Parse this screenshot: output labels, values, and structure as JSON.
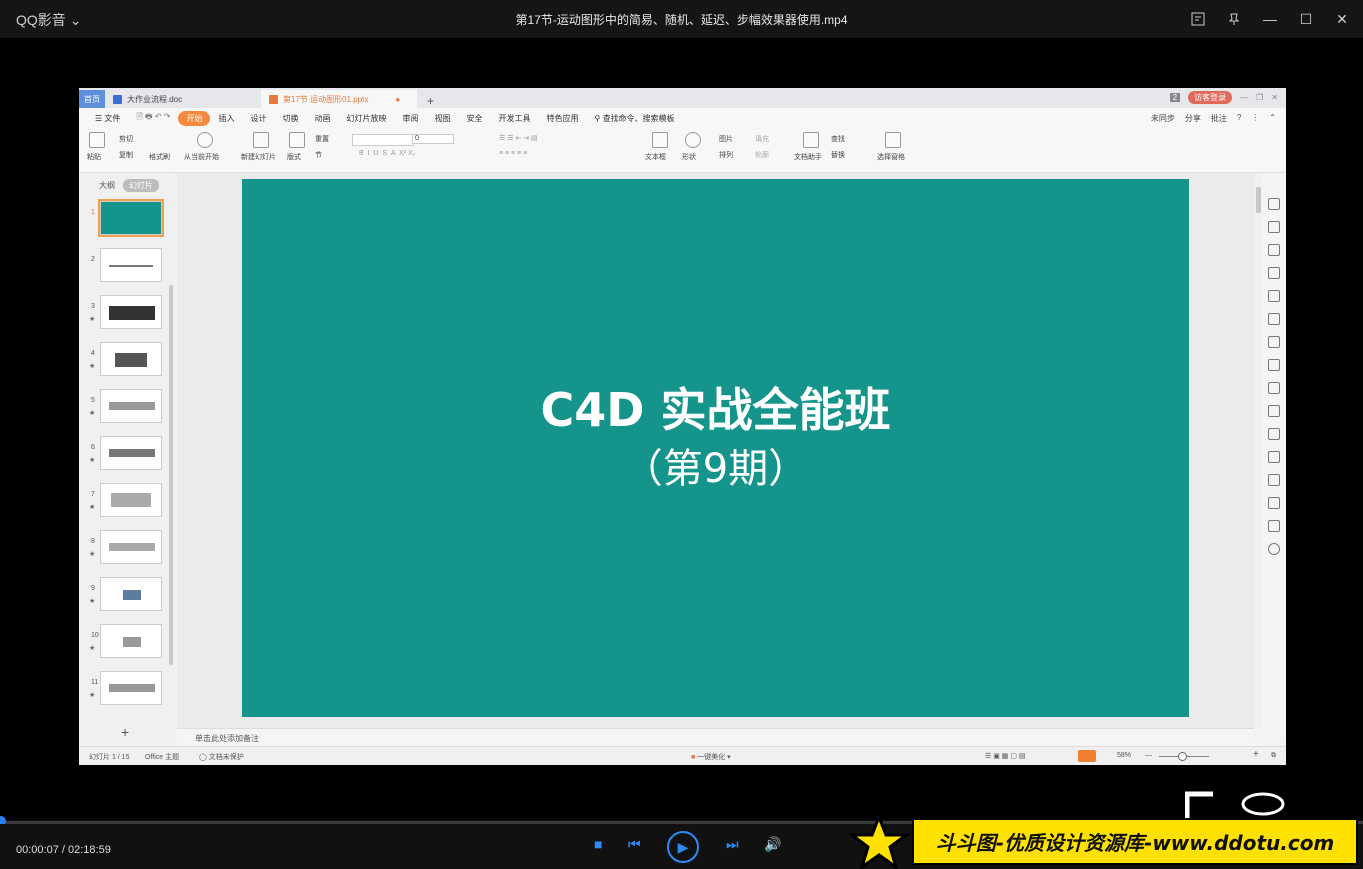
{
  "player": {
    "brand": "QQ影音",
    "title": "第17节-运动图形中的简易、随机、延迟、步幅效果器使用.mp4",
    "time": "00:00:07 / 02:18:59",
    "watermark": "斗斗图-优质设计资源库-www.ddotu.com"
  },
  "wps": {
    "tabs": {
      "home": "首页",
      "doc": "大作业流程.doc",
      "pptx": "第17节 运动图形01.pptx",
      "badge": "2",
      "login": "访客登录"
    },
    "menu": {
      "file": "文件",
      "items": [
        "开始",
        "插入",
        "设计",
        "切换",
        "动画",
        "幻灯片放映",
        "审阅",
        "视图",
        "安全",
        "开发工具",
        "特色应用"
      ],
      "search": "查找命令、搜索模板",
      "right": [
        "未同步",
        "分享",
        "批注"
      ]
    },
    "ribbon": {
      "paste": "粘贴",
      "cut": "剪切",
      "copy": "复制",
      "format_brush": "格式刷",
      "from_current": "从当前开始",
      "new_slide": "新建幻灯片",
      "layout": "版式",
      "section": "节",
      "reset": "重置",
      "font_size": "0",
      "textbox": "文本框",
      "shape": "形状",
      "picture": "图片",
      "arrange": "排列",
      "fill": "填充",
      "outline": "轮廓",
      "doc_helper": "文档助手",
      "find": "查找",
      "replace": "替换",
      "select_pane": "选择窗格"
    },
    "panel": {
      "outline": "大纲",
      "slides": "幻灯片",
      "numbers": [
        "1",
        "2",
        "3",
        "4",
        "5",
        "6",
        "7",
        "8",
        "9",
        "10",
        "11"
      ]
    },
    "slide": {
      "title": "C4D 实战全能班",
      "subtitle": "（第9期）"
    },
    "notes": "单击此处添加备注",
    "status": {
      "slide_count": "幻灯片 1 / 15",
      "theme": "Office 主题",
      "protect": "文档未保护",
      "beautify": "一键美化",
      "zoom": "58%"
    }
  }
}
